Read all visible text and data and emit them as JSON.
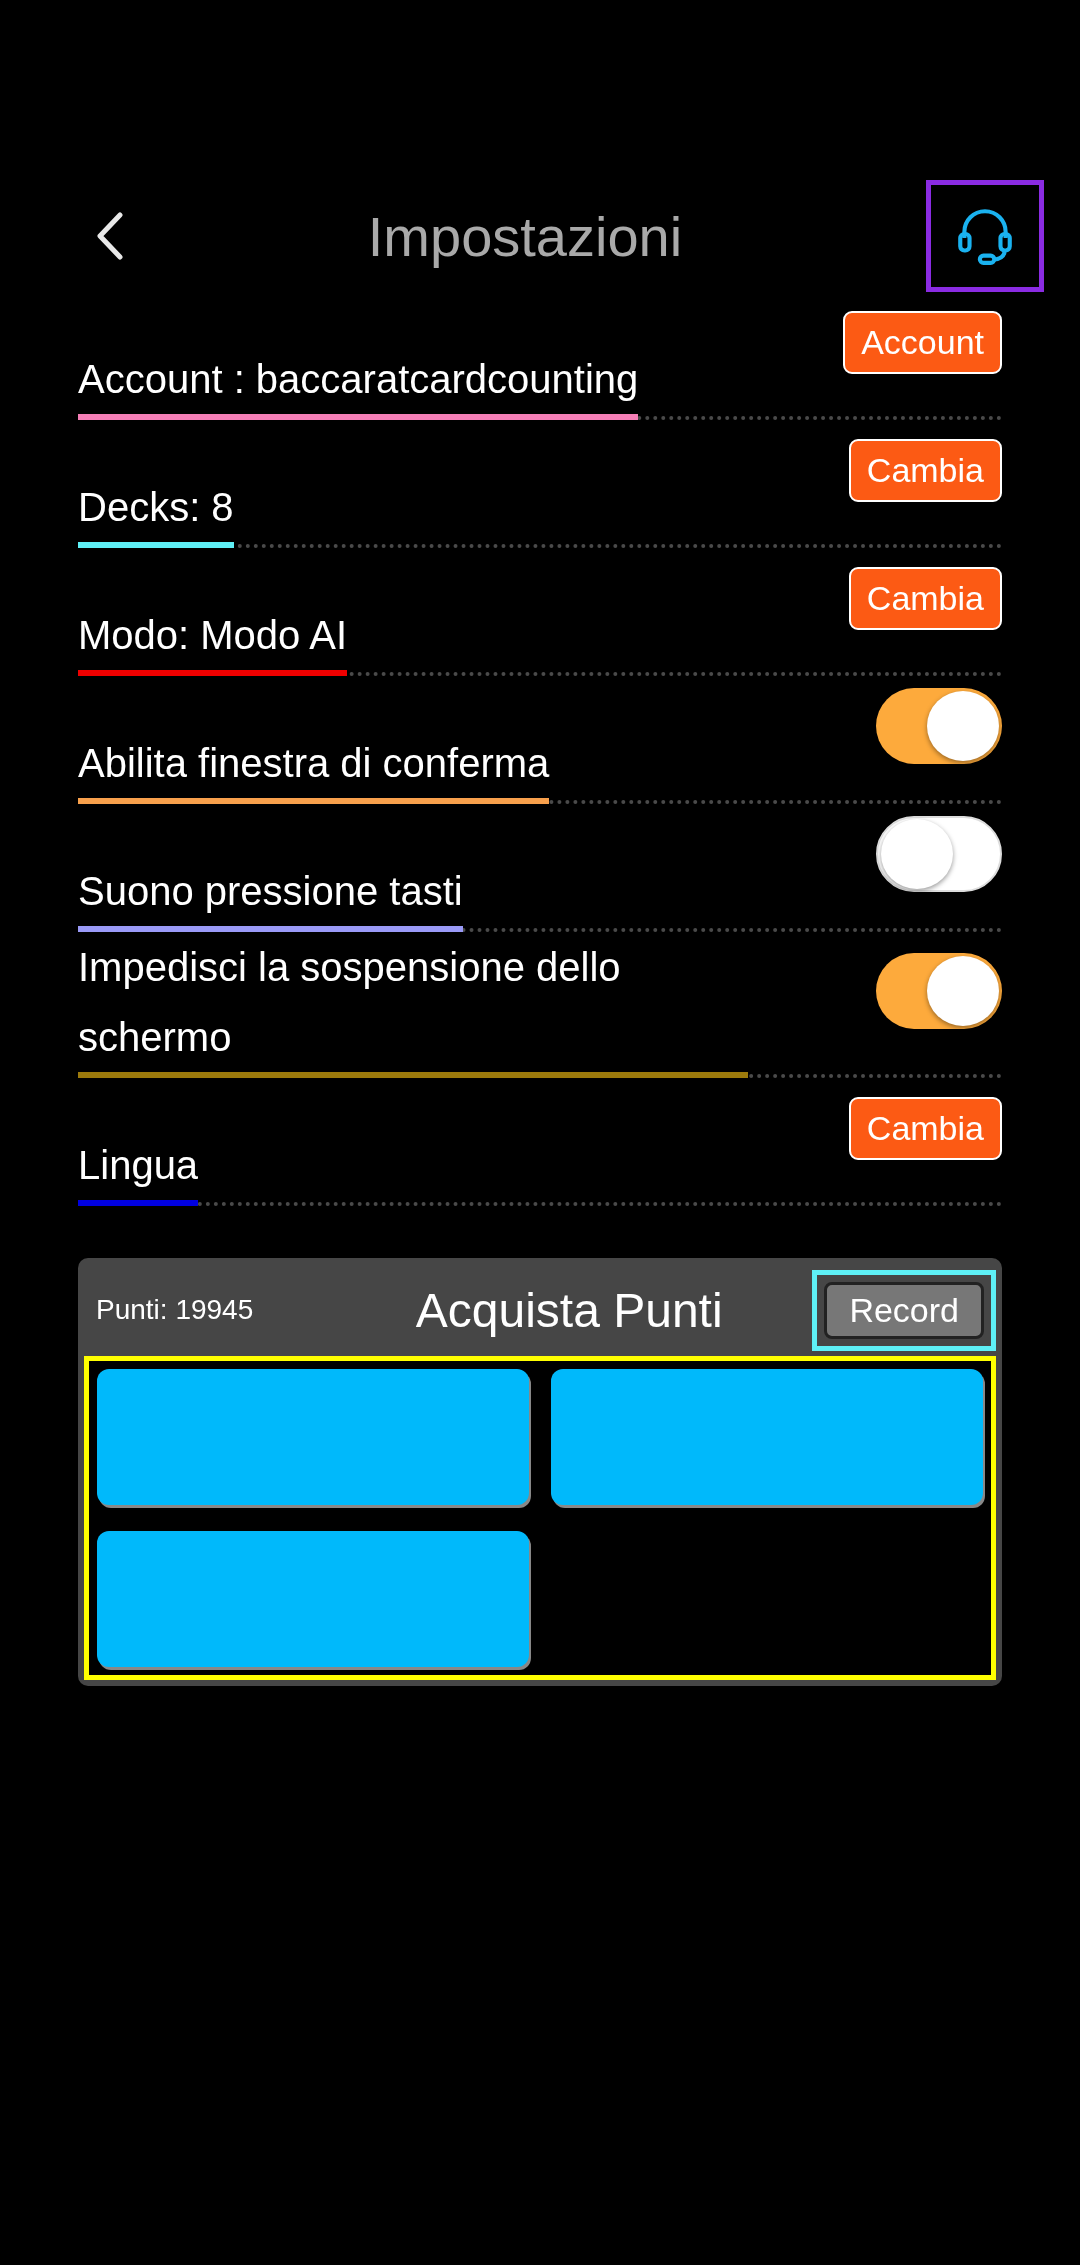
{
  "header": {
    "title": "Impostazioni"
  },
  "settings": [
    {
      "kind": "button",
      "label": "Account : baccaratcardcounting",
      "color": "#f57eb6",
      "button": "Account"
    },
    {
      "kind": "button",
      "label": "Decks: 8",
      "color": "#5ef0f6",
      "button": "Cambia"
    },
    {
      "kind": "button",
      "label": "Modo: Modo AI",
      "color": "#ef0000",
      "button": "Cambia"
    },
    {
      "kind": "toggle",
      "label": "Abilita finestra di conferma",
      "color": "#f8a04c",
      "on": true
    },
    {
      "kind": "toggle",
      "label": "Suono pressione tasti",
      "color": "#9a9af7",
      "on": false
    },
    {
      "kind": "toggle",
      "label": "Impedisci la sospensione dello schermo",
      "color": "#9c7a0c",
      "on": true
    },
    {
      "kind": "button",
      "label": "Lingua",
      "color": "#0000e0",
      "button": "Cambia"
    }
  ],
  "points_panel": {
    "points": "Punti: 19945",
    "title": "Acquista Punti",
    "record_button": "Record",
    "packages": [
      {
        "kind": "tile"
      },
      {
        "kind": "tile"
      },
      {
        "kind": "tile"
      }
    ]
  }
}
